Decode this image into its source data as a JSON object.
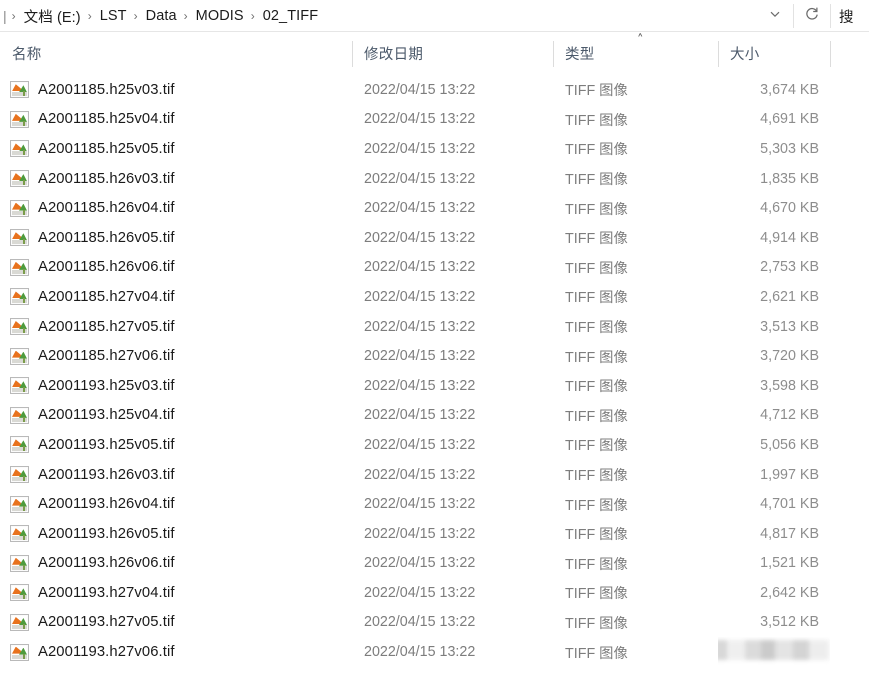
{
  "window": {
    "type": "file-explorer"
  },
  "addressbar": {
    "lead": "|",
    "crumbs": [
      "文档 (E:)",
      "LST",
      "Data",
      "MODIS",
      "02_TIFF"
    ],
    "separator": "›",
    "history_dropdown_icon": "chevron-down-icon",
    "refresh_icon": "refresh-icon",
    "search_stub_text": "搜"
  },
  "columns": {
    "name": "名称",
    "date_modified": "修改日期",
    "type": "类型",
    "size": "大小",
    "sort_indicator": "˄",
    "sorted_by": "类型",
    "sort_direction": "ascending"
  },
  "files": [
    {
      "name": "A2001185.h25v03.tif",
      "date": "2022/04/15 13:22",
      "type": "TIFF 图像",
      "size": "3,674 KB",
      "icon": "tiff-image-icon"
    },
    {
      "name": "A2001185.h25v04.tif",
      "date": "2022/04/15 13:22",
      "type": "TIFF 图像",
      "size": "4,691 KB",
      "icon": "tiff-image-icon"
    },
    {
      "name": "A2001185.h25v05.tif",
      "date": "2022/04/15 13:22",
      "type": "TIFF 图像",
      "size": "5,303 KB",
      "icon": "tiff-image-icon"
    },
    {
      "name": "A2001185.h26v03.tif",
      "date": "2022/04/15 13:22",
      "type": "TIFF 图像",
      "size": "1,835 KB",
      "icon": "tiff-image-icon"
    },
    {
      "name": "A2001185.h26v04.tif",
      "date": "2022/04/15 13:22",
      "type": "TIFF 图像",
      "size": "4,670 KB",
      "icon": "tiff-image-icon"
    },
    {
      "name": "A2001185.h26v05.tif",
      "date": "2022/04/15 13:22",
      "type": "TIFF 图像",
      "size": "4,914 KB",
      "icon": "tiff-image-icon"
    },
    {
      "name": "A2001185.h26v06.tif",
      "date": "2022/04/15 13:22",
      "type": "TIFF 图像",
      "size": "2,753 KB",
      "icon": "tiff-image-icon"
    },
    {
      "name": "A2001185.h27v04.tif",
      "date": "2022/04/15 13:22",
      "type": "TIFF 图像",
      "size": "2,621 KB",
      "icon": "tiff-image-icon"
    },
    {
      "name": "A2001185.h27v05.tif",
      "date": "2022/04/15 13:22",
      "type": "TIFF 图像",
      "size": "3,513 KB",
      "icon": "tiff-image-icon"
    },
    {
      "name": "A2001185.h27v06.tif",
      "date": "2022/04/15 13:22",
      "type": "TIFF 图像",
      "size": "3,720 KB",
      "icon": "tiff-image-icon"
    },
    {
      "name": "A2001193.h25v03.tif",
      "date": "2022/04/15 13:22",
      "type": "TIFF 图像",
      "size": "3,598 KB",
      "icon": "tiff-image-icon"
    },
    {
      "name": "A2001193.h25v04.tif",
      "date": "2022/04/15 13:22",
      "type": "TIFF 图像",
      "size": "4,712 KB",
      "icon": "tiff-image-icon"
    },
    {
      "name": "A2001193.h25v05.tif",
      "date": "2022/04/15 13:22",
      "type": "TIFF 图像",
      "size": "5,056 KB",
      "icon": "tiff-image-icon"
    },
    {
      "name": "A2001193.h26v03.tif",
      "date": "2022/04/15 13:22",
      "type": "TIFF 图像",
      "size": "1,997 KB",
      "icon": "tiff-image-icon"
    },
    {
      "name": "A2001193.h26v04.tif",
      "date": "2022/04/15 13:22",
      "type": "TIFF 图像",
      "size": "4,701 KB",
      "icon": "tiff-image-icon"
    },
    {
      "name": "A2001193.h26v05.tif",
      "date": "2022/04/15 13:22",
      "type": "TIFF 图像",
      "size": "4,817 KB",
      "icon": "tiff-image-icon"
    },
    {
      "name": "A2001193.h26v06.tif",
      "date": "2022/04/15 13:22",
      "type": "TIFF 图像",
      "size": "1,521 KB",
      "icon": "tiff-image-icon"
    },
    {
      "name": "A2001193.h27v04.tif",
      "date": "2022/04/15 13:22",
      "type": "TIFF 图像",
      "size": "2,642 KB",
      "icon": "tiff-image-icon"
    },
    {
      "name": "A2001193.h27v05.tif",
      "date": "2022/04/15 13:22",
      "type": "TIFF 图像",
      "size": "3,512 KB",
      "icon": "tiff-image-icon"
    },
    {
      "name": "A2001193.h27v06.tif",
      "date": "2022/04/15 13:22",
      "type": "TIFF 图像",
      "size": "",
      "size_redacted": true,
      "icon": "tiff-image-icon"
    }
  ],
  "colors": {
    "background": "#ffffff",
    "primary_text": "#1a1a1a",
    "secondary_text": "#7d7d7d",
    "header_text": "#4c5a6b",
    "divider": "#dcdcdc",
    "icon_orange": "#e8721d",
    "icon_green": "#4e9b3c"
  }
}
